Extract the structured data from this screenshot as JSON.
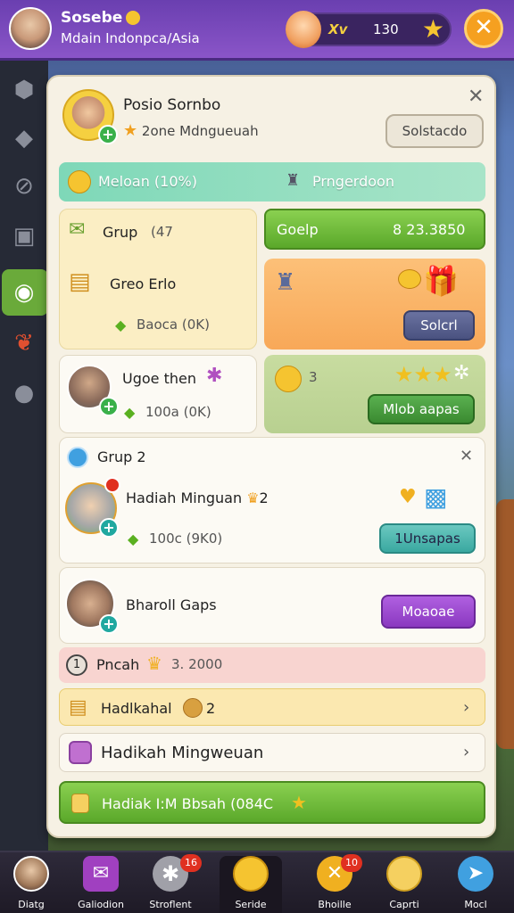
{
  "top_bar": {
    "name": "Sosebe",
    "subtitle": "Mdain Indonpca/Asia",
    "currency_label": "Xv",
    "currency_value": "130",
    "close_icon": "close-icon"
  },
  "panel": {
    "profile_name": "Posio Sornbo",
    "profile_sub": "2one Mdngueuah",
    "top_button": "Solstacdo",
    "teal_row": {
      "left": "Meloan (10%)",
      "right": "Prngerdoon"
    },
    "card1": {
      "title": "Grup",
      "title_count": "(47",
      "item": "Greo Erlo",
      "amount": "Baoca (0K)"
    },
    "card2": {
      "label": "Goelp",
      "value": "8 23.3850"
    },
    "card3": {
      "button": "Solcrl"
    },
    "card4": {
      "title": "Ugoe then",
      "amount": "100a (0K)"
    },
    "card5": {
      "stars": "★★★",
      "count": "3",
      "button": "Mlob aapas"
    },
    "section2": {
      "title": "Grup 2",
      "item": "Hadiah Minguan",
      "item_count": "2",
      "amount": "100c (9K0)",
      "button": "1Unsapas"
    },
    "row_gaps": {
      "label": "Bharoll Gaps",
      "button": "Moaoae"
    },
    "row_pink": {
      "num": "1",
      "label": "Pncah",
      "value": "3. 2000"
    },
    "row_yellow": {
      "label": "Hadlkahal",
      "value": "2"
    },
    "row_lav": {
      "label": "Hadikah Mingweuan"
    },
    "row_green": {
      "label": "Hadiak I:M Bbsah (084C"
    }
  },
  "bottom_nav": [
    {
      "label": "Diatg",
      "badge": ""
    },
    {
      "label": "Galiodion",
      "badge": ""
    },
    {
      "label": "Stroflent",
      "badge": "16"
    },
    {
      "label": "Seride",
      "badge": ""
    },
    {
      "label": "Bhoille",
      "badge": "10"
    },
    {
      "label": "Caprti",
      "badge": ""
    },
    {
      "label": "Mocl",
      "badge": ""
    }
  ],
  "colors": {
    "top_bar": "#7a4ac0",
    "accent_green": "#5aa82a",
    "panel_bg": "#f6f1e4",
    "purple_button": "#9a48d0"
  }
}
